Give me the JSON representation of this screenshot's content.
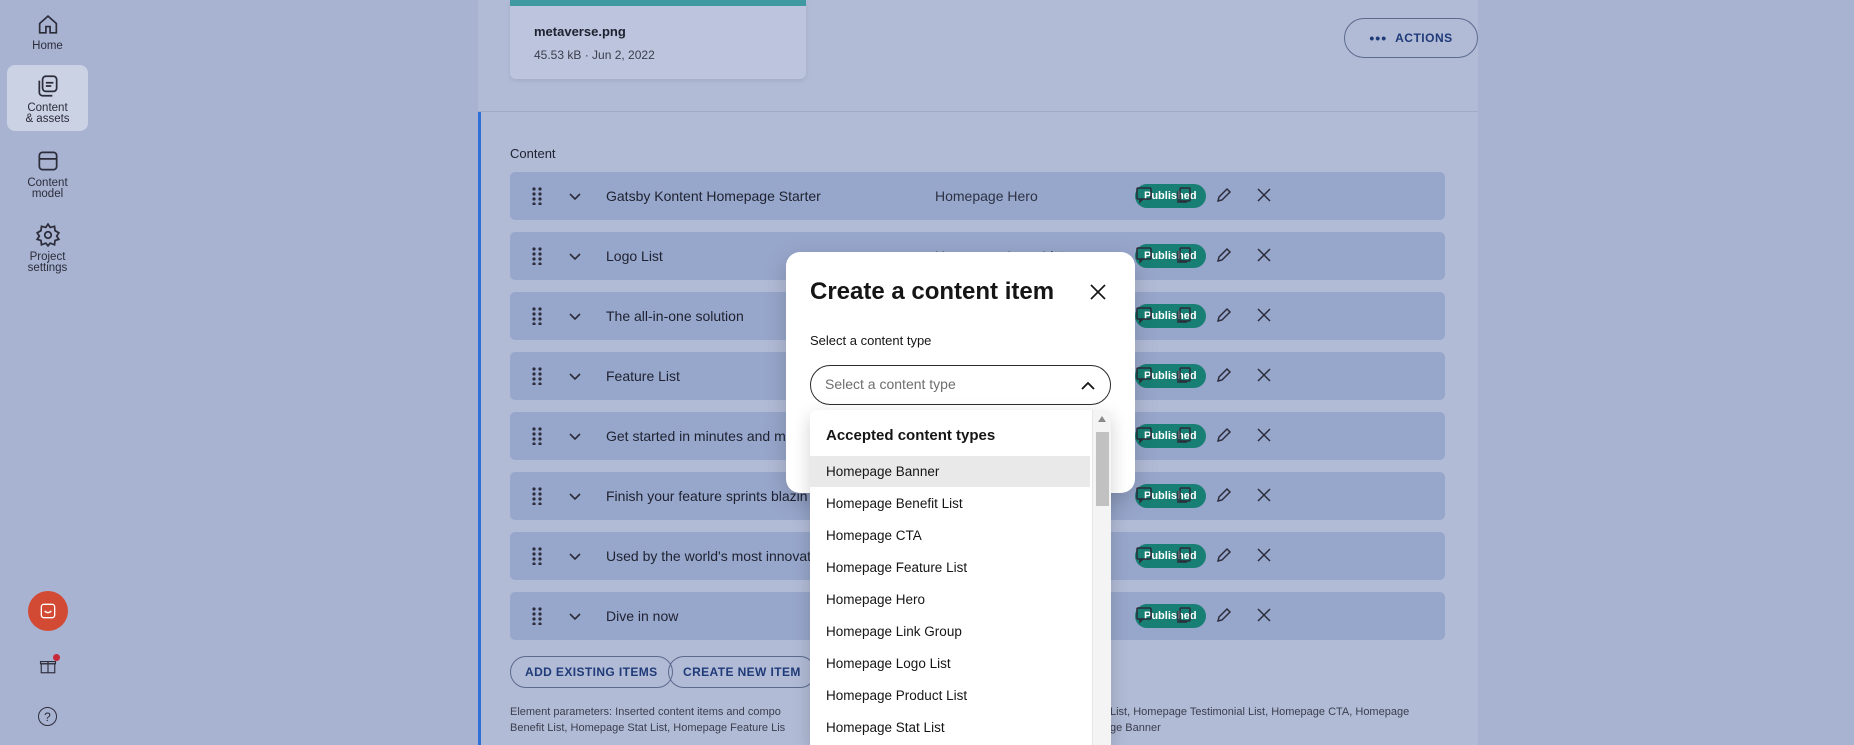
{
  "nav": {
    "home": "Home",
    "content_assets_1": "Content",
    "content_assets_2": "& assets",
    "content_model_1": "Content",
    "content_model_2": "model",
    "project_settings_1": "Project",
    "project_settings_2": "settings"
  },
  "asset": {
    "name": "metaverse.png",
    "meta": "45.53 kB · Jun 2, 2022"
  },
  "actions_label": "ACTIONS",
  "content_label": "Content",
  "rows": [
    {
      "title": "Gatsby Kontent Homepage Starter",
      "type": "Homepage Hero",
      "status": "Published"
    },
    {
      "title": "Logo List",
      "type": "Homepage Logo List",
      "status": "Published"
    },
    {
      "title": "The all-in-one solution",
      "type": "",
      "status": "Published"
    },
    {
      "title": "Feature List",
      "type": "",
      "status": "Published"
    },
    {
      "title": "Get started in minutes and m",
      "type": "",
      "status": "Published"
    },
    {
      "title": "Finish your feature sprints blazin",
      "type": "",
      "status": "Published"
    },
    {
      "title": "Used by the world's most innovati",
      "type": "",
      "status": "Published"
    },
    {
      "title": "Dive in now",
      "type": "",
      "status": "Published"
    }
  ],
  "buttons": {
    "add_existing": "ADD EXISTING ITEMS",
    "create_new": "CREATE NEW ITEM"
  },
  "params": {
    "left_line1": "Element parameters: Inserted content items and compo",
    "left_line2": "Benefit List, Homepage Stat List, Homepage Feature Lis",
    "right_line1": "List, Homepage Testimonial List, Homepage CTA, Homepage",
    "right_line2": "ge Banner"
  },
  "modal": {
    "title": "Create a content item",
    "label": "Select a content type",
    "placeholder": "Select a content type"
  },
  "dropdown": {
    "group": "Accepted content types",
    "items": [
      "Homepage Banner",
      "Homepage Benefit List",
      "Homepage CTA",
      "Homepage Feature List",
      "Homepage Hero",
      "Homepage Link Group",
      "Homepage Logo List",
      "Homepage Product List",
      "Homepage Stat List"
    ]
  },
  "colors": {
    "accent": "#2e6fd8",
    "published": "#177f74",
    "chat": "#d24a34"
  }
}
